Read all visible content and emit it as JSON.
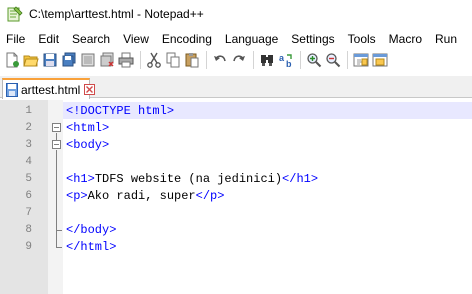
{
  "window": {
    "title": "C:\\temp\\arttest.html - Notepad++"
  },
  "menu": [
    "File",
    "Edit",
    "Search",
    "View",
    "Encoding",
    "Language",
    "Settings",
    "Tools",
    "Macro",
    "Run"
  ],
  "toolbar": {
    "icons": [
      "new-file-icon",
      "open-file-icon",
      "save-icon",
      "save-all-icon",
      "close-icon",
      "close-all-icon",
      "print-icon",
      "cut-icon",
      "copy-icon",
      "paste-icon",
      "undo-icon",
      "redo-icon",
      "find-icon",
      "replace-icon",
      "zoom-in-icon",
      "zoom-out-icon",
      "sync-vertical-icon",
      "sync-horizontal-icon"
    ]
  },
  "tab": {
    "label": "arttest.html"
  },
  "editor": {
    "lines": [
      {
        "num": "1",
        "segments": [
          {
            "t": "tag",
            "v": "<!DOCTYPE html>"
          }
        ]
      },
      {
        "num": "2",
        "segments": [
          {
            "t": "tag",
            "v": "<html>"
          }
        ]
      },
      {
        "num": "3",
        "segments": [
          {
            "t": "tag",
            "v": "<body>"
          }
        ]
      },
      {
        "num": "4",
        "segments": []
      },
      {
        "num": "5",
        "segments": [
          {
            "t": "tag",
            "v": "<h1>"
          },
          {
            "t": "txt",
            "v": "TDFS website (na jedinici)"
          },
          {
            "t": "tag",
            "v": "</h1>"
          }
        ]
      },
      {
        "num": "6",
        "segments": [
          {
            "t": "tag",
            "v": "<p>"
          },
          {
            "t": "txt",
            "v": "Ako radi, super"
          },
          {
            "t": "tag",
            "v": "</p>"
          }
        ]
      },
      {
        "num": "7",
        "segments": []
      },
      {
        "num": "8",
        "segments": [
          {
            "t": "tag",
            "v": "</body>"
          }
        ]
      },
      {
        "num": "9",
        "segments": [
          {
            "t": "tag",
            "v": "</html>"
          }
        ]
      }
    ]
  },
  "colors": {
    "tag": "#0000ff",
    "current_line": "#e8e8ff",
    "gutter": "#e4e4e4"
  }
}
